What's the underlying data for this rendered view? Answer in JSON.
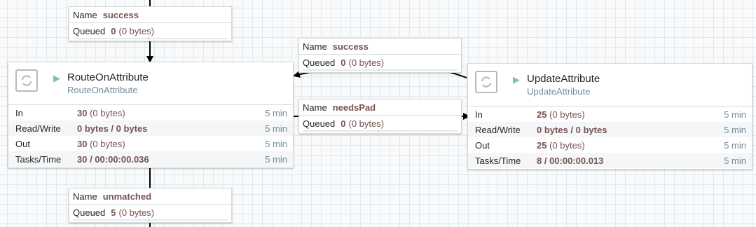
{
  "connections": {
    "top_success": {
      "name_label": "Name",
      "name_value": "success",
      "queued_label": "Queued",
      "queued_count": "0",
      "queued_size": "(0 bytes)"
    },
    "right_success": {
      "name_label": "Name",
      "name_value": "success",
      "queued_label": "Queued",
      "queued_count": "0",
      "queued_size": "(0 bytes)"
    },
    "needs_pad": {
      "name_label": "Name",
      "name_value": "needsPad",
      "queued_label": "Queued",
      "queued_count": "0",
      "queued_size": "(0 bytes)"
    },
    "unmatched": {
      "name_label": "Name",
      "name_value": "unmatched",
      "queued_label": "Queued",
      "queued_count": "5",
      "queued_size": "(0 bytes)"
    }
  },
  "processors": {
    "route": {
      "title": "RouteOnAttribute",
      "type": "RouteOnAttribute",
      "icon": "processor-icon",
      "status_icon": "running-icon",
      "stats": {
        "in": {
          "label": "In",
          "value": "30",
          "size": "(0 bytes)",
          "time": "5 min"
        },
        "rw": {
          "label": "Read/Write",
          "value": "0 bytes / 0 bytes",
          "time": "5 min"
        },
        "out": {
          "label": "Out",
          "value": "30",
          "size": "(0 bytes)",
          "time": "5 min"
        },
        "tasks": {
          "label": "Tasks/Time",
          "value": "30 / 00:00:00.036",
          "time": "5 min"
        }
      }
    },
    "update": {
      "title": "UpdateAttribute",
      "type": "UpdateAttribute",
      "icon": "processor-icon",
      "status_icon": "running-icon",
      "stats": {
        "in": {
          "label": "In",
          "value": "25",
          "size": "(0 bytes)",
          "time": "5 min"
        },
        "rw": {
          "label": "Read/Write",
          "value": "0 bytes / 0 bytes",
          "time": "5 min"
        },
        "out": {
          "label": "Out",
          "value": "25",
          "size": "(0 bytes)",
          "time": "5 min"
        },
        "tasks": {
          "label": "Tasks/Time",
          "value": "8 / 00:00:00.013",
          "time": "5 min"
        }
      }
    }
  },
  "colors": {
    "canvas": "#f9fafb",
    "grid": "#e3e8eb",
    "value": "#775351",
    "muted": "#728e9b",
    "running": "#7dc7a0"
  }
}
